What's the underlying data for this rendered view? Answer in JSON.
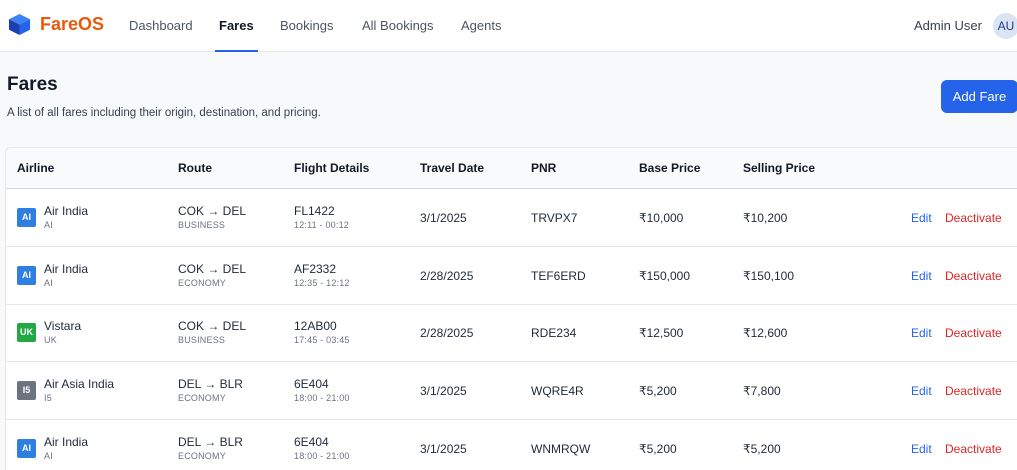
{
  "brand": {
    "name": "FareOS",
    "icon": "cube-logo-icon"
  },
  "nav": [
    {
      "label": "Dashboard",
      "active": false
    },
    {
      "label": "Fares",
      "active": true
    },
    {
      "label": "Bookings",
      "active": false
    },
    {
      "label": "All Bookings",
      "active": false
    },
    {
      "label": "Agents",
      "active": false
    }
  ],
  "user": {
    "name": "Admin User",
    "initials": "AU"
  },
  "page": {
    "title": "Fares",
    "subtitle": "A list of all fares including their origin, destination, and pricing.",
    "add_button": "Add Fare"
  },
  "table": {
    "columns": [
      "Airline",
      "Route",
      "Flight Details",
      "Travel Date",
      "PNR",
      "Base Price",
      "Selling Price"
    ],
    "action_labels": {
      "edit": "Edit",
      "deactivate": "Deactivate"
    },
    "rows": [
      {
        "code": "AI",
        "code_color": "#2f7fe0",
        "airline": "Air India",
        "route": "COK → DEL",
        "cabin": "BUSINESS",
        "flight": "FL1422",
        "times": "12:11 - 00:12",
        "date": "3/1/2025",
        "pnr": "TRVPX7",
        "base": "₹10,000",
        "selling": "₹10,200"
      },
      {
        "code": "AI",
        "code_color": "#2f7fe0",
        "airline": "Air India",
        "route": "COK → DEL",
        "cabin": "ECONOMY",
        "flight": "AF2332",
        "times": "12:35 - 12:12",
        "date": "2/28/2025",
        "pnr": "TEF6ERD",
        "base": "₹150,000",
        "selling": "₹150,100"
      },
      {
        "code": "UK",
        "code_color": "#22a845",
        "airline": "Vistara",
        "route": "COK → DEL",
        "cabin": "BUSINESS",
        "flight": "12AB00",
        "times": "17:45 - 03:45",
        "date": "2/28/2025",
        "pnr": "RDE234",
        "base": "₹12,500",
        "selling": "₹12,600"
      },
      {
        "code": "I5",
        "code_color": "#6b7280",
        "airline": "Air Asia India",
        "route": "DEL → BLR",
        "cabin": "ECONOMY",
        "flight": "6E404",
        "times": "18:00 - 21:00",
        "date": "3/1/2025",
        "pnr": "WQRE4R",
        "base": "₹5,200",
        "selling": "₹7,800"
      },
      {
        "code": "AI",
        "code_color": "#2f7fe0",
        "airline": "Air India",
        "route": "DEL → BLR",
        "cabin": "ECONOMY",
        "flight": "6E404",
        "times": "18:00 - 21:00",
        "date": "3/1/2025",
        "pnr": "WNMRQW",
        "base": "₹5,200",
        "selling": "₹5,200"
      }
    ]
  }
}
